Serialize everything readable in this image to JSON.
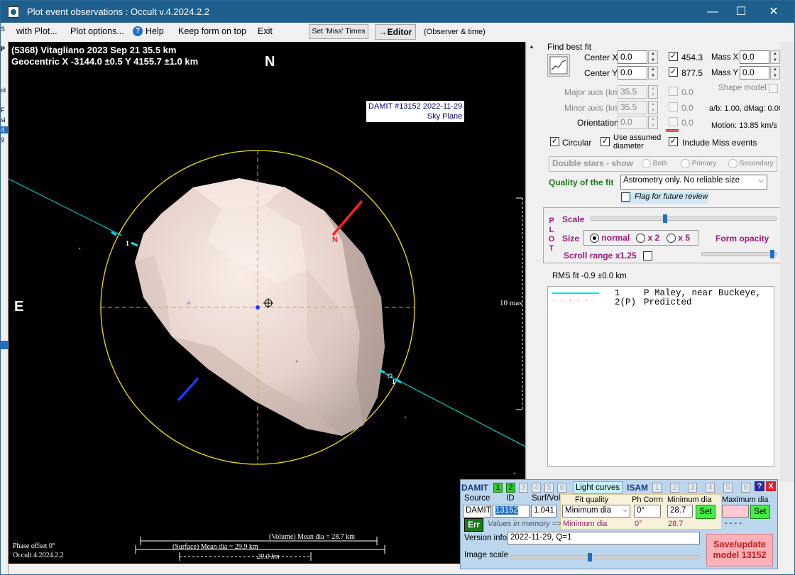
{
  "window": {
    "title": "Plot event observations : Occult v.4.2024.2.2",
    "controls": {
      "minimize": "—",
      "maximize": "☐",
      "close": "✕"
    }
  },
  "menu": {
    "with_plot": "with Plot...",
    "plot_options": "Plot options...",
    "help": "Help",
    "keep_on_top": "Keep form on top",
    "exit": "Exit",
    "set_miss_times": "Set 'Miss' Times",
    "editor": "→Editor",
    "observer_time": "(Observer & time)"
  },
  "left_strip": [
    "S",
    "P",
    "ol",
    "F",
    "si",
    "4",
    "9"
  ],
  "plot": {
    "event_line": "(5368) Vitagliano  2023 Sep 21   35.5 km",
    "geocentric_line": "Geocentric  X  -3144.0 ±0.5  Y 4155.7 ±1.0 km",
    "north": "N",
    "east": "E",
    "damit_label_1": "DAMIT #13152 2022-11-29",
    "damit_label_2": "Sky Plane",
    "scale_label": "10 mas",
    "north_marker": "N",
    "chord_label_1": "1",
    "chord_label_2": "1",
    "phase_offset": "Phase offset 0°",
    "occult_version": "Occult 4.2024.2.2",
    "volume_mean": "(Volume) Mean dia = 28.7 km",
    "surface_mean": "(Surface) Mean dia = 29.9 km",
    "km_scale": "20.0 km"
  },
  "fit": {
    "find_best_fit": "Find best fit",
    "center_x_label": "Center X",
    "center_x": "0.0",
    "center_y_label": "Center Y",
    "center_y": "0.0",
    "chk_x_value": "454.3",
    "chk_y_value": "877.5",
    "mass_x_label": "Mass X",
    "mass_x": "0.0",
    "mass_y_label": "Mass Y",
    "mass_y": "0.0",
    "major_axis_label": "Major axis (km)",
    "major_axis": "35.5",
    "major_chk_value": "0.0",
    "minor_axis_label": "Minor axis (km)",
    "minor_axis": "35.5",
    "minor_chk_value": "0.0",
    "orientation_label": "Orientation",
    "orientation": "0.0",
    "orient_chk_value": "0.0",
    "shape_model": "Shape model",
    "ab_dmag": "a/b: 1.00, dMag: 0.00",
    "motion": "Motion: 13.85 km/s",
    "circular": "Circular",
    "use_assumed_1": "Use assumed",
    "use_assumed_2": "diameter",
    "include_miss": "Include Miss events",
    "double_stars": "Double stars - show",
    "both": "Both",
    "primary": "Primary",
    "secondary": "Secondary",
    "quality_label": "Quality of the fit",
    "quality_value": "Astrometry only. No reliable size",
    "flag_review": "Flag for future review"
  },
  "plot_controls": {
    "plot_vertical": [
      "P",
      "L",
      "O",
      "T"
    ],
    "scale": "Scale",
    "size": "Size",
    "normal": "normal",
    "x2": "x 2",
    "x5": "x 5",
    "form_opacity": "Form opacity",
    "scroll_range": "Scroll range x1.25",
    "scale_level": 0.4,
    "opacity_level": 0.97
  },
  "rms_fit": "RMS fit -0.9 ±0.0 km",
  "legend": [
    {
      "id": "1",
      "name": "P Maley, near Buckeye,",
      "style": "line",
      "color": "#00e5ee"
    },
    {
      "id": "2(P)",
      "name": "Predicted",
      "style": "dots",
      "color": "#e05050"
    }
  ],
  "damit_panel": {
    "damit": "DAMIT",
    "damit_models": [
      "1",
      "2",
      "3",
      "4",
      "5",
      "6"
    ],
    "light_curves": "Light curves",
    "isam": "ISAM",
    "isam_models": [
      "1",
      "2",
      "3",
      "4",
      "5",
      "6"
    ],
    "help_q": "?",
    "close_x": "X",
    "source_hdr": "Source",
    "id_hdr": "ID",
    "surf_vol_hdr": "Surf/Vol",
    "source": "DAMIT",
    "id": "13152",
    "surf_vol": "1.041",
    "fit_quality_hdr": "Fit quality",
    "fit_quality": "Minimum dia",
    "fit_quality_2": "Minimum dia",
    "ph_corr_hdr": "Ph Corrn",
    "ph_corr": "0°",
    "ph_corr_2": "0°",
    "min_dia_hdr": "Minimum dia",
    "min_dia": "28.7",
    "min_dia_2": "28.7",
    "max_dia_hdr": "Maximum dia",
    "max_dia_2": "- - - -",
    "set": "Set",
    "err": "Err",
    "values_memory": "Values in memory =>",
    "version_info_label": "Version info",
    "version_info": "2022-11-29, Q=1",
    "image_scale": "Image scale",
    "image_scale_level": 0.42,
    "save_update_1": "Save/update",
    "save_update_2": "model 13152"
  },
  "colors": {
    "title_bar": "#1e5f8e",
    "sky": "#000000",
    "limb_circle": "#f0e000",
    "chord": "#00e5ee",
    "axes": "#ff9a00",
    "pole_north": "#ff2020",
    "pole_south": "#1a3cff",
    "asteroid_light": "#f4e6e0",
    "asteroid_dark": "#b8a8a2",
    "save_button": "#ffb0b8",
    "set_button": "#44ee44"
  }
}
